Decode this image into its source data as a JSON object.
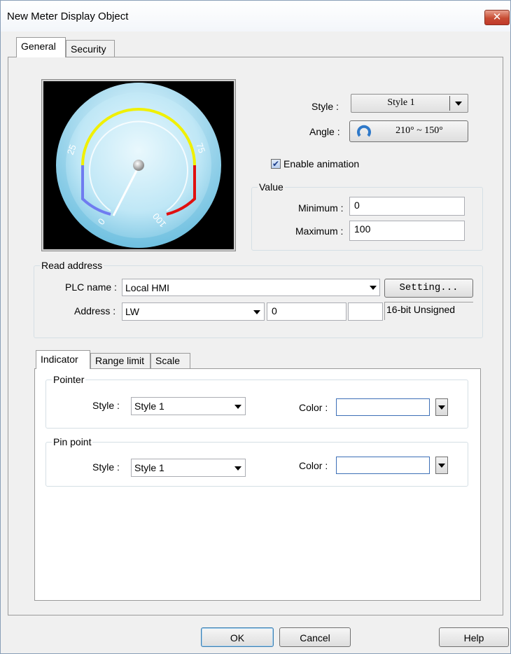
{
  "window": {
    "title": "New  Meter Display Object",
    "close_glyph": "✕"
  },
  "tabs": [
    {
      "label": "General",
      "active": true
    },
    {
      "label": "Security",
      "active": false
    }
  ],
  "meter_preview": {
    "tick_labels": [
      "0",
      "25",
      "75",
      "100"
    ],
    "arc_colors": {
      "low": "#6f7cf0",
      "mid": "#f0f000",
      "high": "#e01010"
    },
    "face_color": "#bfe7f6"
  },
  "style": {
    "label": "Style :",
    "value": "Style 1"
  },
  "angle": {
    "label": "Angle :",
    "value": "210° ~ 150°"
  },
  "enable_animation": {
    "label": "Enable animation",
    "checked": true,
    "check_glyph": "✔"
  },
  "value_group": {
    "title": "Value",
    "minimum_label": "Minimum :",
    "minimum_value": "0",
    "maximum_label": "Maximum :",
    "maximum_value": "100"
  },
  "read_address": {
    "title": "Read address",
    "plc_name_label": "PLC name :",
    "plc_name_value": "Local HMI",
    "setting_button": "Setting...",
    "address_label": "Address :",
    "address_type": "LW",
    "address_value": "0",
    "data_format": "16-bit Unsigned"
  },
  "subtabs": [
    {
      "label": "Indicator",
      "active": true
    },
    {
      "label": "Range limit",
      "active": false
    },
    {
      "label": "Scale",
      "active": false
    }
  ],
  "pointer": {
    "title": "Pointer",
    "style_label": "Style :",
    "style_value": "Style 1",
    "color_label": "Color :"
  },
  "pin_point": {
    "title": "Pin point",
    "style_label": "Style :",
    "style_value": "Style 1",
    "color_label": "Color :"
  },
  "footer": {
    "ok": "OK",
    "cancel": "Cancel",
    "help": "Help"
  }
}
